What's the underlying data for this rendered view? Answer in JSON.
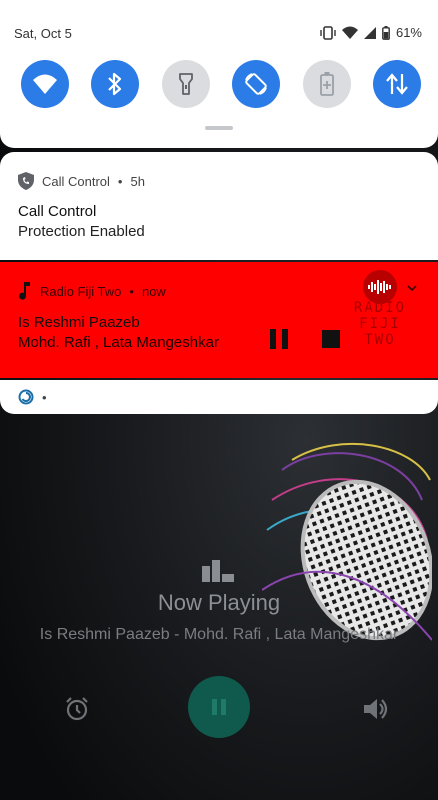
{
  "status_bar": {
    "date": "Sat, Oct 5",
    "battery_percent": "61%",
    "icons": [
      "vibrate-icon",
      "wifi-icon",
      "cell-signal-icon",
      "battery-icon"
    ]
  },
  "quick_settings": {
    "tiles": [
      {
        "icon": "wifi-icon",
        "state": "on"
      },
      {
        "icon": "bluetooth-icon",
        "state": "on"
      },
      {
        "icon": "flashlight-icon",
        "state": "off"
      },
      {
        "icon": "auto-rotate-icon",
        "state": "on"
      },
      {
        "icon": "battery-saver-icon",
        "state": "off"
      },
      {
        "icon": "mobile-data-icon",
        "state": "on"
      }
    ],
    "accent_color": "#2b7ce6"
  },
  "notifications": {
    "call_control": {
      "app_name": "Call Control",
      "separator": "•",
      "time": "5h",
      "title": "Call Control",
      "text": "Protection Enabled"
    },
    "media": {
      "app_name": "Radio Fiji Two",
      "separator": "•",
      "time": "now",
      "title": "Is Reshmi Paazeb",
      "artist": "Mohd. Rafi , Lata Mangeshkar",
      "background_color": "#ff0000",
      "art_text_line1": "RADIO",
      "art_text_line2": "FIJI TWO"
    },
    "small": {
      "separator": "•"
    }
  },
  "app": {
    "now_playing_label": "Now Playing",
    "now_playing_subtitle": "Is Reshmi Paazeb - Mohd. Rafi , Lata Mangeshkar",
    "play_button_color": "#0f5a4c"
  }
}
